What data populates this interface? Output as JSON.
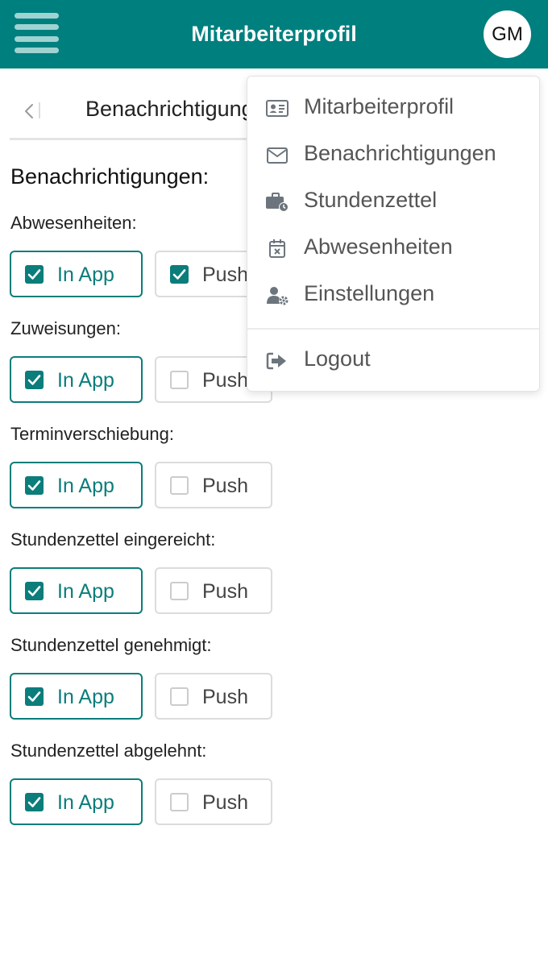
{
  "header": {
    "title": "Mitarbeiterprofil",
    "avatar_initials": "GM",
    "background_color": "#007F7F"
  },
  "breadcrumb": {
    "current": "Benachrichtigungen"
  },
  "section": {
    "title": "Benachrichtigungen:"
  },
  "groups": [
    {
      "label": "Abwesenheiten:",
      "in_app_label": "In App",
      "in_app_checked": true,
      "push_label": "Push",
      "push_checked": true
    },
    {
      "label": "Zuweisungen:",
      "in_app_label": "In App",
      "in_app_checked": true,
      "push_label": "Push",
      "push_checked": false
    },
    {
      "label": "Terminverschiebung:",
      "in_app_label": "In App",
      "in_app_checked": true,
      "push_label": "Push",
      "push_checked": false
    },
    {
      "label": "Stundenzettel eingereicht:",
      "in_app_label": "In App",
      "in_app_checked": true,
      "push_label": "Push",
      "push_checked": false
    },
    {
      "label": "Stundenzettel genehmigt:",
      "in_app_label": "In App",
      "in_app_checked": true,
      "push_label": "Push",
      "push_checked": false
    },
    {
      "label": "Stundenzettel abgelehnt:",
      "in_app_label": "In App",
      "in_app_checked": true,
      "push_label": "Push",
      "push_checked": false
    }
  ],
  "user_menu": {
    "items": [
      {
        "label": "Mitarbeiterprofil",
        "icon": "id-card-icon"
      },
      {
        "label": "Benachrichtigungen",
        "icon": "envelope-icon"
      },
      {
        "label": "Stundenzettel",
        "icon": "briefcase-clock-icon"
      },
      {
        "label": "Abwesenheiten",
        "icon": "calendar-x-icon"
      },
      {
        "label": "Einstellungen",
        "icon": "user-gear-icon"
      }
    ],
    "logout": {
      "label": "Logout",
      "icon": "sign-out-icon"
    }
  },
  "colors": {
    "accent": "#0B7D7B",
    "header_bg": "#007F7F",
    "icon_gray": "#6C757D"
  }
}
